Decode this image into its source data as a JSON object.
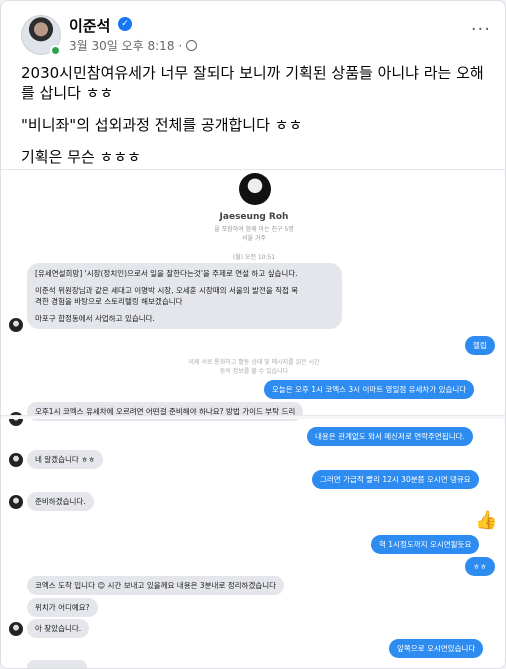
{
  "post": {
    "author": "이준석",
    "date": "3월 30일 오후 8:18",
    "verified_icon": "verified-badge-icon",
    "privacy_icon": "globe-icon",
    "more_label": "···",
    "lines": [
      "2030시민참여유세가 너무 잘되다 보니까 기획된 상품들 아니냐 라는 오해를 삽니다 ㅎㅎ",
      "\"비니좌\"의 섭외과정 전체를 공개합니다 ㅎㅎ",
      "기획은 무슨 ㅎㅎㅎ"
    ]
  },
  "chat": {
    "profile_name": "Jaeseung Roh",
    "profile_sub": "을 포함하여 함께 아는 친구 5명",
    "profile_loc": "서울 거주",
    "time_stamp": "(월) 오전 10:51",
    "messages_in_1": [
      "[유세연설희망] '시장(정치인)으로서 일을 잘한다는것'을 주제로 연설 하고 싶습니다.",
      "이준석 위원장님과 같은 세대고 이명박 시장, 오세훈 시장때의 서울의 발전을 직접 목",
      "격한 경험을 바탕으로 스토리텔링 해보겠습니다",
      "마포구 합정동에서 사업하고 있습니다."
    ],
    "out_1": "헬립",
    "sys_1": "이제 서로 통화하고 활동 상태 및 메시지를 읽은 시간",
    "sys_2": "등의 정보를 볼 수 있습니다",
    "out_2": "오늘은 오후 1시 코엑스 3시 이마트 영일점 유세차가 있습니다",
    "in_2": "오후1시 코엑스 유세차에 오르려면 어떤걸 준비해야 하나요? 방법 가이드 부탁 드리",
    "out_3": "내용은 관계없도 와서 메신저로 연락주면됩니다.",
    "in_3": "네 알겠습니다 ㅎㅎ",
    "out_4": "그러면 가급적 빨리 12시 30분쯤 오시면 댕큐요",
    "in_4": "준비하겠습니다.",
    "thumb_icon": "thumbs-up-icon",
    "out_5": "혁 1시정도까지 오시면될듯요",
    "out_6": "ㅎㅎ",
    "in_5": "코엑스 도착 입니다 😊 시간 보내고 있을께요 내용은 3분내로 정리하겠습니다",
    "in_6": "위치가 어디예요?",
    "in_7": "아 찾았습니다.",
    "out_7": "앞쪽으로 오시면있습니다"
  }
}
